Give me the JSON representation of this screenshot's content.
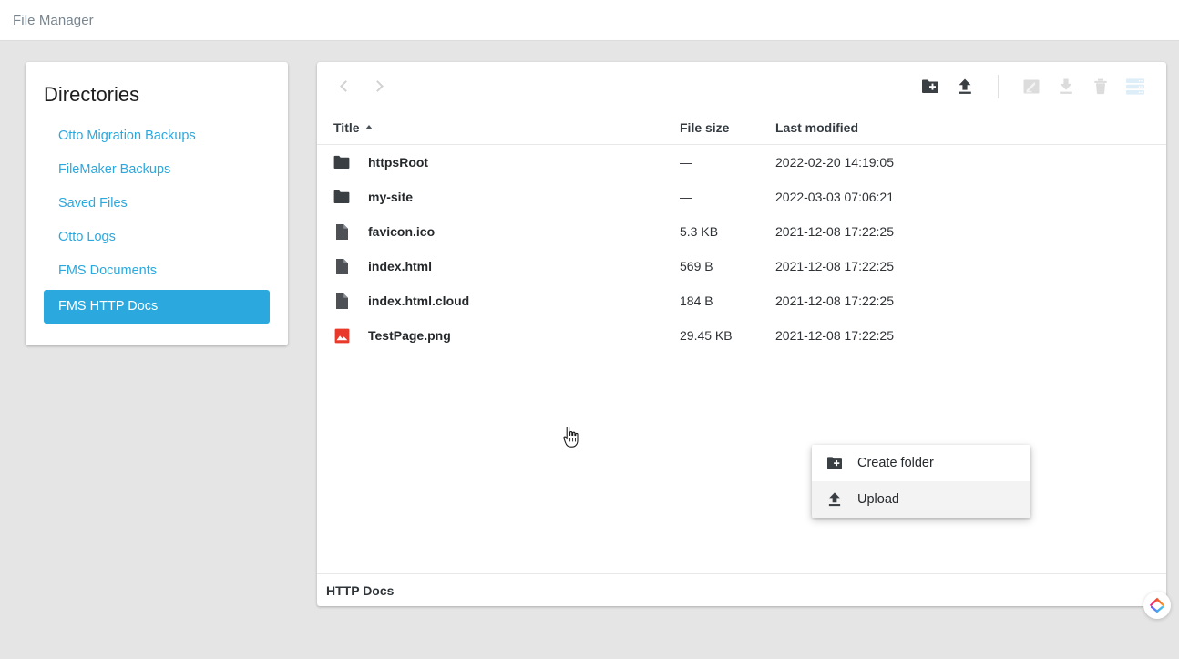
{
  "appbar": {
    "title": "File Manager"
  },
  "sidebar": {
    "title": "Directories",
    "items": [
      {
        "label": "Otto Migration Backups",
        "active": false
      },
      {
        "label": "FileMaker Backups",
        "active": false
      },
      {
        "label": "Saved Files",
        "active": false
      },
      {
        "label": "Otto Logs",
        "active": false
      },
      {
        "label": "FMS Documents",
        "active": false
      },
      {
        "label": "FMS HTTP Docs",
        "active": true
      }
    ],
    "active_color": "#2ba8dd",
    "link_color": "#2ba8dd"
  },
  "toolbar": {
    "back_icon": "chevron-left-icon",
    "forward_icon": "chevron-right-icon",
    "buttons": [
      {
        "name": "create-folder-button",
        "icon": "folder-plus-icon",
        "enabled": true
      },
      {
        "name": "upload-button",
        "icon": "upload-icon",
        "enabled": true
      },
      {
        "name": "rename-button",
        "icon": "rename-pencil-icon",
        "enabled": false
      },
      {
        "name": "download-button",
        "icon": "download-icon",
        "enabled": false
      },
      {
        "name": "delete-button",
        "icon": "trash-icon",
        "enabled": false
      },
      {
        "name": "storage-button",
        "icon": "server-stack-icon",
        "enabled": true
      }
    ]
  },
  "table": {
    "columns": [
      {
        "key": "title",
        "label": "Title",
        "sorted": true,
        "sort_dir": "asc"
      },
      {
        "key": "size",
        "label": "File size"
      },
      {
        "key": "modified",
        "label": "Last modified"
      }
    ],
    "rows": [
      {
        "icon": "folder-icon",
        "title": "httpsRoot",
        "size": "—",
        "modified": "2022-02-20 14:19:05"
      },
      {
        "icon": "folder-icon",
        "title": "my-site",
        "size": "—",
        "modified": "2022-03-03 07:06:21"
      },
      {
        "icon": "file-icon",
        "title": "favicon.ico",
        "size": "5.3 KB",
        "modified": "2021-12-08 17:22:25"
      },
      {
        "icon": "file-icon",
        "title": "index.html",
        "size": "569 B",
        "modified": "2021-12-08 17:22:25"
      },
      {
        "icon": "file-icon",
        "title": "index.html.cloud",
        "size": "184 B",
        "modified": "2021-12-08 17:22:25"
      },
      {
        "icon": "image-icon",
        "title": "TestPage.png",
        "size": "29.45 KB",
        "modified": "2021-12-08 17:22:25"
      }
    ]
  },
  "footer": {
    "path_label": "HTTP Docs"
  },
  "context_menu": {
    "items": [
      {
        "label": "Create folder",
        "icon": "folder-plus-icon",
        "hovered": false
      },
      {
        "label": "Upload",
        "icon": "upload-icon",
        "hovered": true
      }
    ]
  },
  "brand": {
    "name": "app-logo-badge"
  },
  "colors": {
    "page_bg": "#e5e5e5",
    "panel_bg": "#ffffff",
    "accent": "#2ba8dd",
    "image_icon": "#e8392b",
    "file_icon": "#4d5156",
    "folder_icon": "#3a3f44",
    "disabled": "#d6d6d6"
  }
}
